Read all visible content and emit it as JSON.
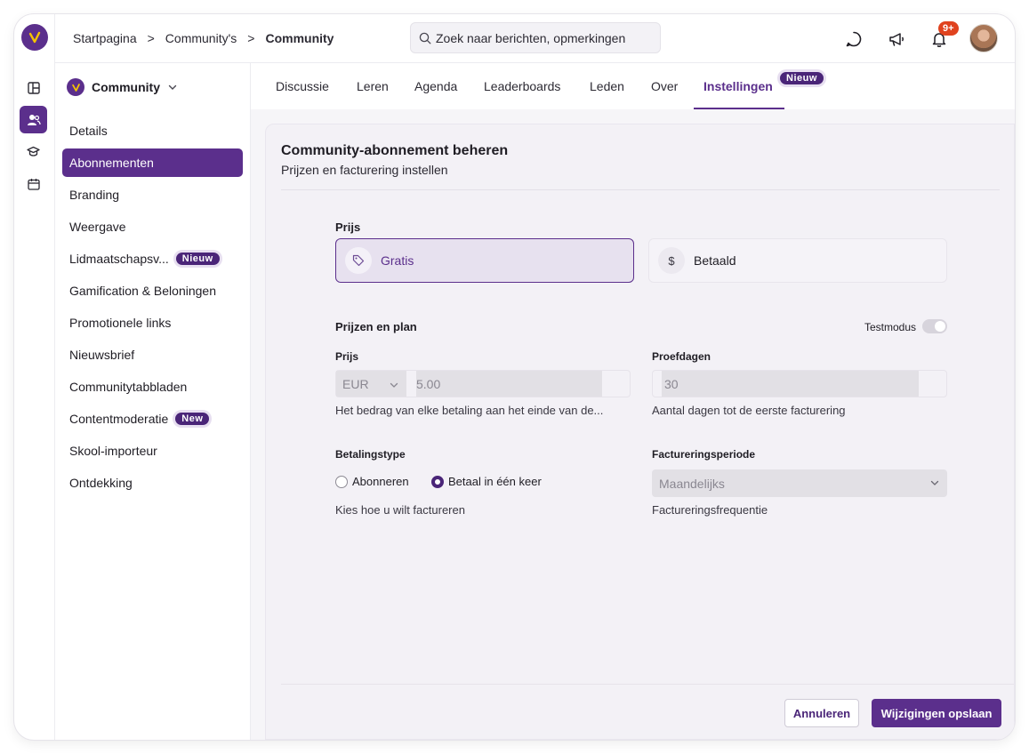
{
  "breadcrumb": [
    "Startpagina",
    "Community's",
    "Community"
  ],
  "search": {
    "placeholder": "Zoek naar berichten, opmerkingen"
  },
  "header": {
    "notifications_badge": "9+"
  },
  "sidebar": {
    "community_name": "Community",
    "items": [
      {
        "label": "Details"
      },
      {
        "label": "Abonnementen",
        "active": true
      },
      {
        "label": "Branding"
      },
      {
        "label": "Weergave"
      },
      {
        "label": "Lidmaatschapsv...",
        "badge": "Nieuw"
      },
      {
        "label": "Gamification & Beloningen"
      },
      {
        "label": "Promotionele links"
      },
      {
        "label": "Nieuwsbrief"
      },
      {
        "label": "Communitytabbladen"
      },
      {
        "label": "Contentmoderatie",
        "badge": "New"
      },
      {
        "label": "Skool-importeur"
      },
      {
        "label": "Ontdekking"
      }
    ]
  },
  "tabs": [
    {
      "label": "Discussie"
    },
    {
      "label": "Leren"
    },
    {
      "label": "Agenda"
    },
    {
      "label": "Leaderboards"
    },
    {
      "label": "Leden"
    },
    {
      "label": "Over"
    },
    {
      "label": "Instellingen",
      "active": true,
      "badge": "Nieuw"
    }
  ],
  "card": {
    "title": "Community-abonnement beheren",
    "subtitle": "Prijzen en facturering instellen",
    "price_section_label": "Prijs",
    "options": {
      "free": "Gratis",
      "paid": "Betaald",
      "paid_symbol": "$"
    },
    "plan_label": "Prijzen en plan",
    "test_mode_label": "Testmodus",
    "test_mode_on": false,
    "price_label": "Prijs",
    "currency": "EUR",
    "price_value": "5.00",
    "price_help": "Het bedrag van elke betaling aan het einde van de...",
    "trial_label": "Proefdagen",
    "trial_value": "30",
    "trial_help": "Aantal dagen tot de eerste facturering",
    "payment_type_label": "Betalingstype",
    "payment_types": [
      "Abonneren",
      "Betaal in één keer"
    ],
    "payment_type_selected": "Betaal in één keer",
    "payment_type_help": "Kies hoe u wilt factureren",
    "billing_period_label": "Factureringsperiode",
    "billing_period_value": "Maandelijks",
    "billing_period_help": "Factureringsfrequentie"
  },
  "footer": {
    "cancel_label": "Annuleren",
    "save_label": "Wijzigingen opslaan"
  },
  "colors": {
    "brand": "#5b2f8c",
    "badge_dark": "#4a2578",
    "notification": "#e0431f"
  }
}
